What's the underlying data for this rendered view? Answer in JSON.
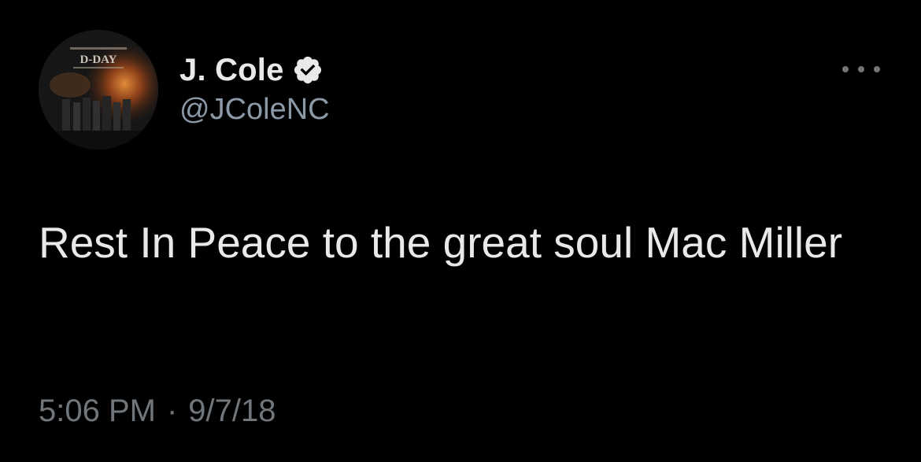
{
  "author": {
    "display_name": "J. Cole",
    "handle": "@JColeNC",
    "avatar_icon": "album-cover-avatar",
    "verified_icon": "verified-badge-icon",
    "avatar_text": "D-DAY"
  },
  "tweet": {
    "text": "Rest In Peace to the great soul Mac Miller",
    "time": "5:06 PM",
    "separator": "·",
    "date": "9/7/18"
  },
  "menu": {
    "icon": "more-options-icon"
  },
  "colors": {
    "background": "#000000",
    "primary_text": "#e7e9ea",
    "secondary_text": "#71767b",
    "verified_badge": "#e7e9ea"
  }
}
